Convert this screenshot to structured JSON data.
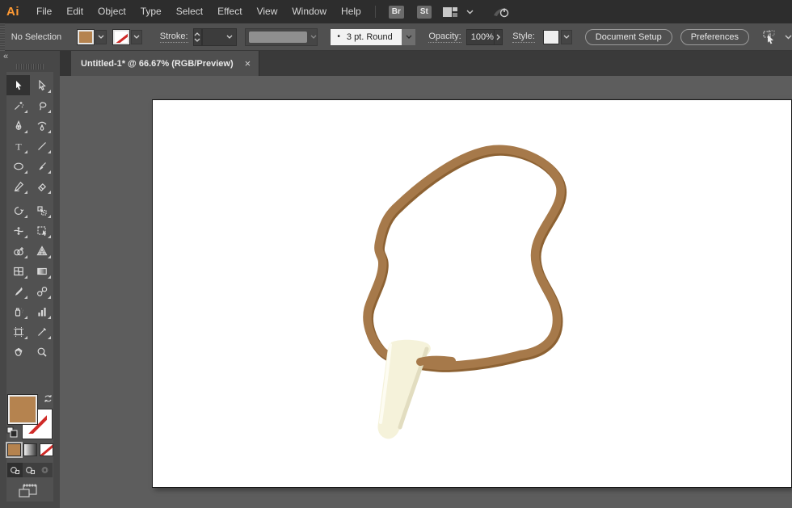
{
  "app": {
    "logo_text": "Ai",
    "logo_color": "#ff9a33"
  },
  "menu_bar": {
    "items": [
      "File",
      "Edit",
      "Object",
      "Type",
      "Select",
      "Effect",
      "View",
      "Window",
      "Help"
    ],
    "bridge_button": "Br",
    "stock_button": "St"
  },
  "control_bar": {
    "selection_status": "No Selection",
    "fill_color": "#b5834f",
    "stroke_swatch": "none",
    "stroke_label": "Stroke:",
    "brush_preview_glyph": "•",
    "brush_definition": "3 pt. Round",
    "opacity_label": "Opacity:",
    "opacity_value": "100%",
    "style_label": "Style:",
    "document_setup_button": "Document Setup",
    "preferences_button": "Preferences"
  },
  "document_tab": {
    "title": "Untitled-1* @ 66.67% (RGB/Preview)",
    "close_glyph": "×"
  },
  "toolbar": {
    "collapse_glyph": "«",
    "fill_swatch_color": "#b5834f",
    "stroke_swatch": "none",
    "tools": [
      "selection",
      "direct-selection",
      "magic-wand",
      "lasso",
      "pen",
      "curvature",
      "type",
      "line-segment",
      "ellipse",
      "paintbrush",
      "shaper",
      "eraser",
      "rotate",
      "scale",
      "width",
      "free-transform",
      "shape-builder",
      "perspective-grid",
      "mesh",
      "gradient",
      "eyedropper",
      "blend",
      "symbol-sprayer",
      "column-graph",
      "artboard",
      "slice",
      "hand",
      "zoom"
    ],
    "type_tool_glyph": "T"
  },
  "artwork": {
    "description": "Brown cord necklace loop with ivory tooth pendant on white artboard",
    "cord_color": "#a6794a",
    "cord_shadow_color": "#8d6233",
    "pendant_fill": "#f5f2da",
    "pendant_shade": "#e2ddc0",
    "pendant_highlight": "#fdfcf2"
  }
}
